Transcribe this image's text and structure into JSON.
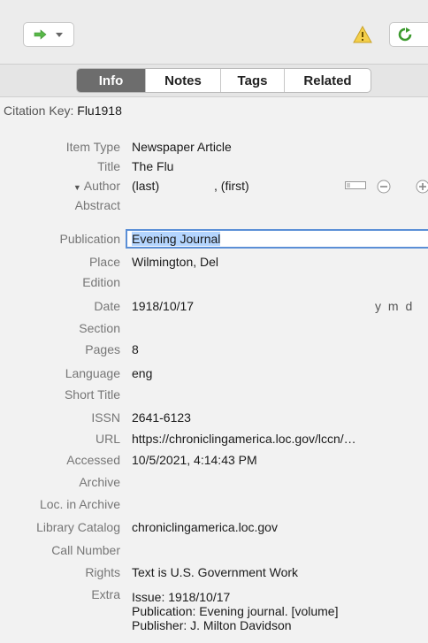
{
  "toolbar": {
    "go_icon": "green-arrow-icon",
    "dropdown_icon": "chevron-down-icon",
    "warning_icon": "warning-icon",
    "refresh_icon": "refresh-icon"
  },
  "tabs": [
    "Info",
    "Notes",
    "Tags",
    "Related"
  ],
  "active_tab": "Info",
  "citation": {
    "label": "Citation Key:",
    "value": "Flu1918"
  },
  "fields": [
    {
      "label": "Item Type",
      "value": "Newspaper Article"
    },
    {
      "label": "Title",
      "value": "The Flu"
    },
    {
      "label": "Author",
      "value": "(last)",
      "value2": ", (first)"
    },
    {
      "label": "Abstract",
      "value": ""
    },
    {
      "label": "Publication",
      "value": "Evening Journal"
    },
    {
      "label": "Place",
      "value": "Wilmington, Del"
    },
    {
      "label": "Edition",
      "value": ""
    },
    {
      "label": "Date",
      "value": "1918/10/17",
      "hint": "y m d"
    },
    {
      "label": "Section",
      "value": ""
    },
    {
      "label": "Pages",
      "value": "8"
    },
    {
      "label": "Language",
      "value": "eng"
    },
    {
      "label": "Short Title",
      "value": ""
    },
    {
      "label": "ISSN",
      "value": "2641-6123"
    },
    {
      "label": "URL",
      "value": "https://chroniclingamerica.loc.gov/lccn/…"
    },
    {
      "label": "Accessed",
      "value": "10/5/2021, 4:14:43 PM"
    },
    {
      "label": "Archive",
      "value": ""
    },
    {
      "label": "Loc. in Archive",
      "value": ""
    },
    {
      "label": "Library Catalog",
      "value": "chroniclingamerica.loc.gov"
    },
    {
      "label": "Call Number",
      "value": ""
    },
    {
      "label": "Rights",
      "value": "Text is U.S. Government Work"
    },
    {
      "label": "Extra",
      "lines": [
        "Issue: 1918/10/17",
        "Publication: Evening journal. [volume]",
        "Publisher: J. Milton Davidson"
      ]
    }
  ]
}
